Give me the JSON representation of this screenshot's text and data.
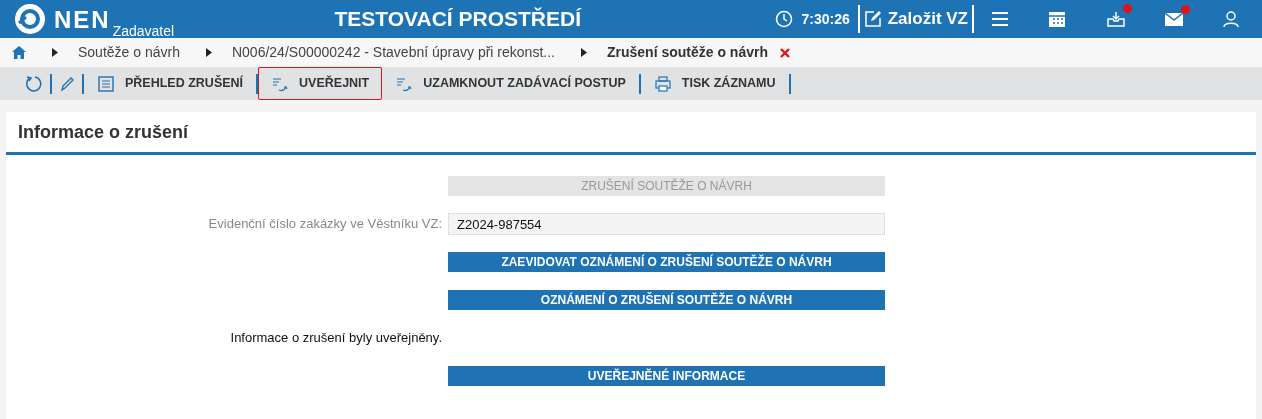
{
  "header": {
    "logo": "NEN",
    "subtitle": "Zadavatel",
    "title": "TESTOVACÍ PROSTŘEDÍ",
    "time": "7:30:26",
    "create": "Založit VZ",
    "badges": {
      "inbox": true,
      "mail": true
    }
  },
  "breadcrumb": [
    {
      "label": "Soutěže o návrh",
      "current": false
    },
    {
      "label": "N006/24/S00000242 - Stavební úpravy při rekonst...",
      "current": false
    },
    {
      "label": "Zrušení soutěže o návrh",
      "current": true
    }
  ],
  "toolbar": [
    {
      "kind": "refresh"
    },
    {
      "kind": "edit"
    },
    {
      "kind": "list",
      "label": "PŘEHLED ZRUŠENÍ",
      "highlighted": false
    },
    {
      "kind": "publish",
      "label": "UVEŘEJNIT",
      "highlighted": true
    },
    {
      "kind": "publish",
      "label": "UZAMKNOUT ZADÁVACÍ POSTUP",
      "highlighted": false
    },
    {
      "kind": "print",
      "label": "TISK ZÁZNAMU",
      "highlighted": false
    }
  ],
  "section": {
    "title": "Informace o zrušení",
    "rows": [
      {
        "kind": "button",
        "label": "ZRUŠENÍ SOUTĚŽE O NÁVRH",
        "disabled": true
      },
      {
        "kind": "field",
        "label": "Evidenční číslo zakázky ve Věstníku VZ:",
        "value": "Z2024-987554"
      },
      {
        "kind": "button",
        "label": "ZAEVIDOVAT OZNÁMENÍ O ZRUŠENÍ SOUTĚŽE O NÁVRH",
        "disabled": false
      },
      {
        "kind": "button",
        "label": "OZNÁMENÍ O ZRUŠENÍ SOUTĚŽE O NÁVRH",
        "disabled": false
      },
      {
        "kind": "text",
        "label": "Informace o zrušení byly uveřejněny."
      },
      {
        "kind": "button",
        "label": "UVEŘEJNĚNÉ INFORMACE",
        "disabled": false
      }
    ]
  }
}
